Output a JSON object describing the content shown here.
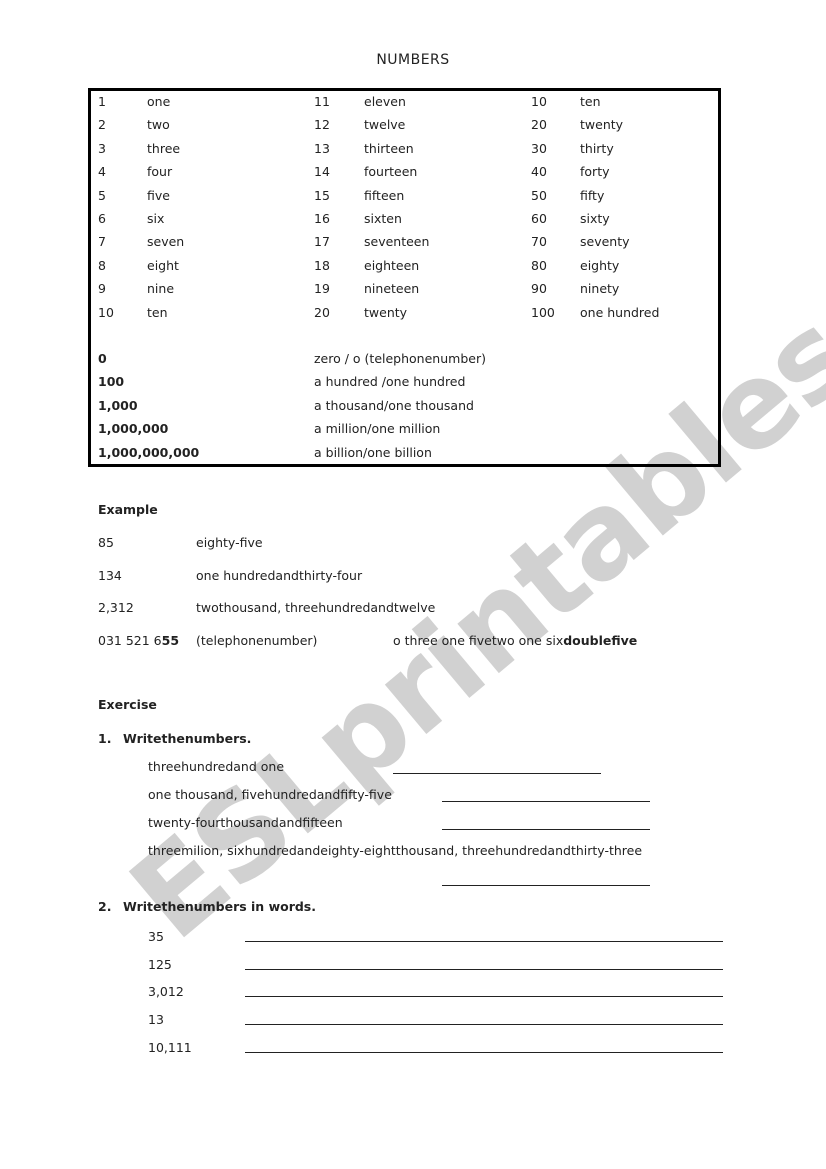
{
  "title": "NUMBERS",
  "watermark": "ESLprintables.com",
  "table": {
    "columns": [
      [
        {
          "num": "1",
          "word": "one"
        },
        {
          "num": "2",
          "word": "two"
        },
        {
          "num": "3",
          "word": "three"
        },
        {
          "num": "4",
          "word": "four"
        },
        {
          "num": "5",
          "word": "five"
        },
        {
          "num": "6",
          "word": "six"
        },
        {
          "num": "7",
          "word": "seven"
        },
        {
          "num": "8",
          "word": "eight"
        },
        {
          "num": "9",
          "word": "nine"
        },
        {
          "num": "10",
          "word": "ten"
        }
      ],
      [
        {
          "num": "11",
          "word": "eleven"
        },
        {
          "num": "12",
          "word": "twelve"
        },
        {
          "num": "13",
          "word": "thirteen"
        },
        {
          "num": "14",
          "word": "fourteen"
        },
        {
          "num": "15",
          "word": "fifteen"
        },
        {
          "num": "16",
          "word": "sixten"
        },
        {
          "num": "17",
          "word": "seventeen"
        },
        {
          "num": "18",
          "word": "eighteen"
        },
        {
          "num": "19",
          "word": "nineteen"
        },
        {
          "num": "20",
          "word": "twenty"
        }
      ],
      [
        {
          "num": "10",
          "word": "ten"
        },
        {
          "num": "20",
          "word": "twenty"
        },
        {
          "num": "30",
          "word": "thirty"
        },
        {
          "num": "40",
          "word": "forty"
        },
        {
          "num": "50",
          "word": "fifty"
        },
        {
          "num": "60",
          "word": "sixty"
        },
        {
          "num": "70",
          "word": "seventy"
        },
        {
          "num": "80",
          "word": "eighty"
        },
        {
          "num": "90",
          "word": "ninety"
        },
        {
          "num": "100",
          "word": "one hundred"
        }
      ]
    ],
    "large": [
      {
        "num": "0",
        "word": "zero  /  o (telephonenumber)"
      },
      {
        "num": "100",
        "word": "a hundred /one hundred"
      },
      {
        "num": "1,000",
        "word": "a thousand/one thousand"
      },
      {
        "num": "1,000,000",
        "word": "a million/one million"
      },
      {
        "num": "1,000,000,000",
        "word": "a billion/one billion"
      }
    ]
  },
  "example": {
    "heading": "Example",
    "rows": [
      {
        "num": "85",
        "words": "eighty-five"
      },
      {
        "num": "134",
        "words": "one hundredandthirty-four"
      },
      {
        "num": "2,312",
        "words": "twothousand, threehundredandtwelve"
      }
    ],
    "phone": {
      "num_prefix": "031 521 6",
      "num_bold": "55",
      "note": "(telephonenumber)",
      "reading": "o three one fivetwo one six",
      "reading_bold": "doublefive"
    }
  },
  "exercise": {
    "heading": "Exercise",
    "task1": {
      "number": "1.",
      "instruction": "Writethenumbers.",
      "items": [
        "threehundredand one",
        "one thousand, fivehundredandfifty-five",
        "twenty-fourthousandandfifteen",
        "threemilion, sixhundredandeighty-eightthousand, threehundredandthirty-three"
      ]
    },
    "task2": {
      "number": "2.",
      "instruction": "Writethenumbers in words.",
      "items": [
        "35",
        "125",
        "3,012",
        "13",
        "10,111"
      ]
    }
  }
}
